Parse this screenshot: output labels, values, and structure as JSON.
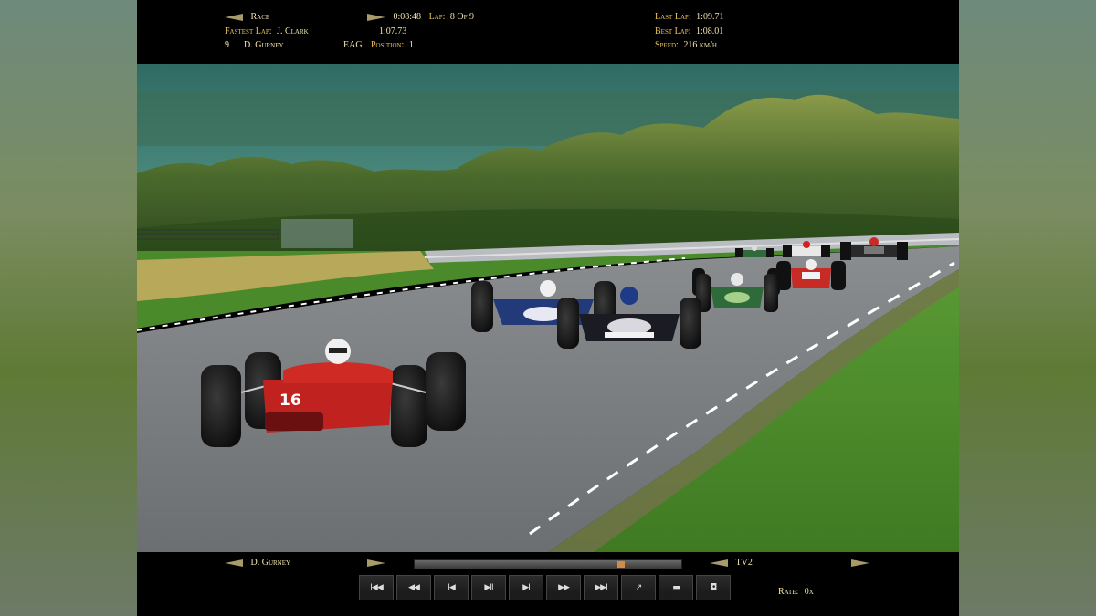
{
  "hud": {
    "mode_label": "Race",
    "session_time": "0:08:48",
    "lap_label": "Lap:",
    "lap_value": "8 Of 9",
    "last_lap_label": "Last Lap:",
    "last_lap_value": "1:09.71",
    "fastest_lap_label": "Fastest Lap:",
    "fastest_lap_driver": "J. Clark",
    "fastest_lap_time": "1:07.73",
    "best_lap_label": "Best Lap:",
    "best_lap_value": "1:08.01",
    "driver_number": "9",
    "driver_name": "D. Gurney",
    "team_code": "EAG",
    "position_label": "Position:",
    "position_value": "1",
    "speed_label": "Speed:",
    "speed_value": "216 km/h"
  },
  "playback": {
    "driver_select": "D. Gurney",
    "camera_select": "TV2",
    "progress_fraction": 0.78,
    "rate_label": "Rate:",
    "rate_value": "0x",
    "buttons": [
      {
        "name": "skip-to-start",
        "glyph": "I◀◀"
      },
      {
        "name": "rewind",
        "glyph": "◀◀"
      },
      {
        "name": "step-back",
        "glyph": "I◀"
      },
      {
        "name": "play-pause",
        "glyph": "▶II"
      },
      {
        "name": "step-forward",
        "glyph": "▶I"
      },
      {
        "name": "fast-forward",
        "glyph": "▶▶"
      },
      {
        "name": "skip-to-end",
        "glyph": "▶▶I"
      },
      {
        "name": "camera-toggle",
        "glyph": "↗"
      },
      {
        "name": "folder",
        "glyph": "▬"
      },
      {
        "name": "window",
        "glyph": "◘"
      }
    ]
  },
  "scene": {
    "car_numbers": {
      "lead_car": "16"
    },
    "colors": {
      "lead_car": "#c0231f",
      "blue_car": "#233a7a",
      "dark_car": "#1b1b24",
      "green_car": "#2f6a3a",
      "red_car": "#c82a25",
      "white_car": "#e8e8e8",
      "grass": "#4e8a2c",
      "track": "#777a7c",
      "sky": "#3c7a6e"
    }
  }
}
